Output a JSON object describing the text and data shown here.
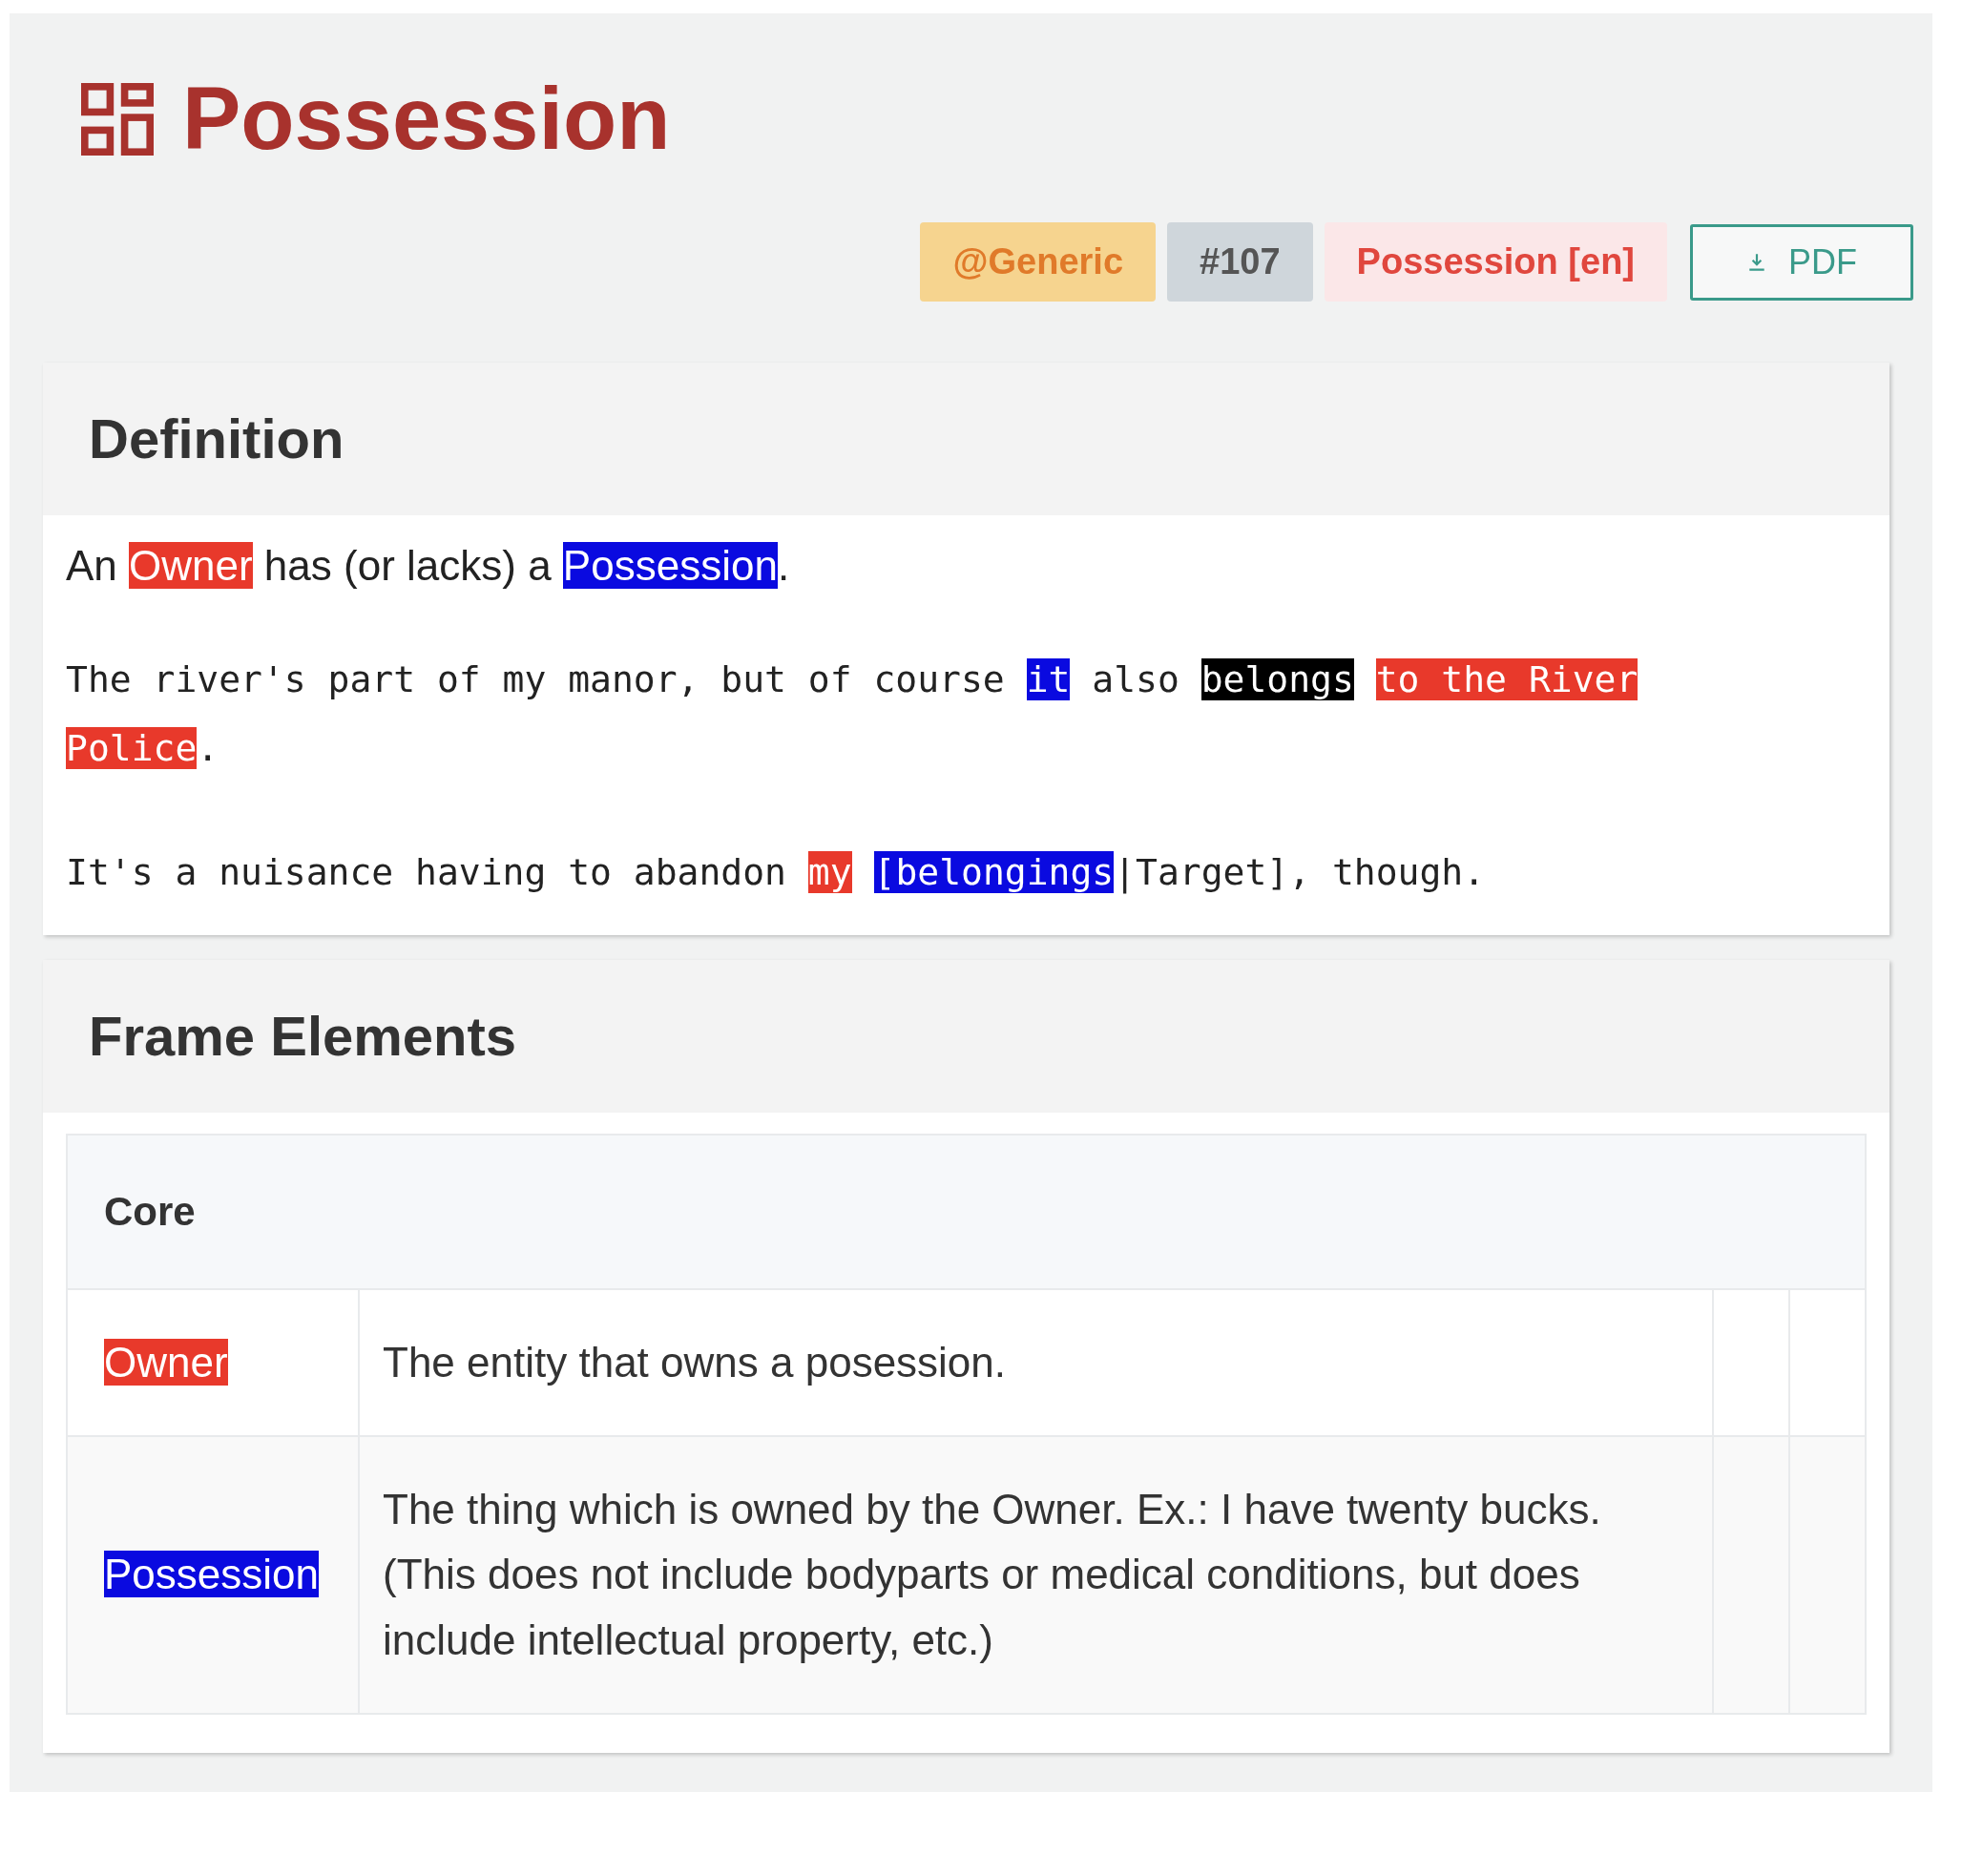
{
  "title": "Possession",
  "badges": [
    {
      "kind": "generic",
      "label": "@Generic"
    },
    {
      "kind": "id",
      "label": "#107"
    },
    {
      "kind": "lexicon",
      "label": "Possession [en]"
    }
  ],
  "pdf_button": {
    "label": "PDF"
  },
  "definition": {
    "heading": "Definition",
    "paragraphs": [
      {
        "kind": "prose",
        "segments": [
          {
            "text": "An "
          },
          {
            "text": "Owner",
            "color": "#e8392b"
          },
          {
            "text": " has (or lacks) a "
          },
          {
            "text": "Possession",
            "color": "#0a0ae0"
          },
          {
            "text": "."
          }
        ]
      },
      {
        "kind": "example",
        "segments": [
          {
            "text": "The river's part of my manor, but of course "
          },
          {
            "text": "it",
            "color": "#0a0ae0"
          },
          {
            "text": " also "
          },
          {
            "text": "belongs",
            "color": "#000000",
            "space_after": true
          },
          {
            "text": "to the River Police",
            "color": "#e8392b"
          },
          {
            "text": "."
          }
        ]
      },
      {
        "kind": "example",
        "segments": [
          {
            "text": "It's a nuisance having to abandon "
          },
          {
            "text": "my",
            "color": "#e8392b",
            "space_after": true
          },
          {
            "text": "[belongings",
            "color": "#0a0ae0"
          },
          {
            "text": "|Target], though."
          }
        ]
      }
    ]
  },
  "frame_elements": {
    "heading": "Frame Elements",
    "group": "Core",
    "rows": [
      {
        "name": "Owner",
        "color": "#e8392b",
        "description": "The entity that owns a posession."
      },
      {
        "name": "Possession",
        "color": "#0a0ae0",
        "description": "The thing which is owned by the Owner. Ex.: I have twenty bucks. (This does not include bodyparts or medical conditions, but does include intellectual property, etc.)"
      }
    ]
  }
}
